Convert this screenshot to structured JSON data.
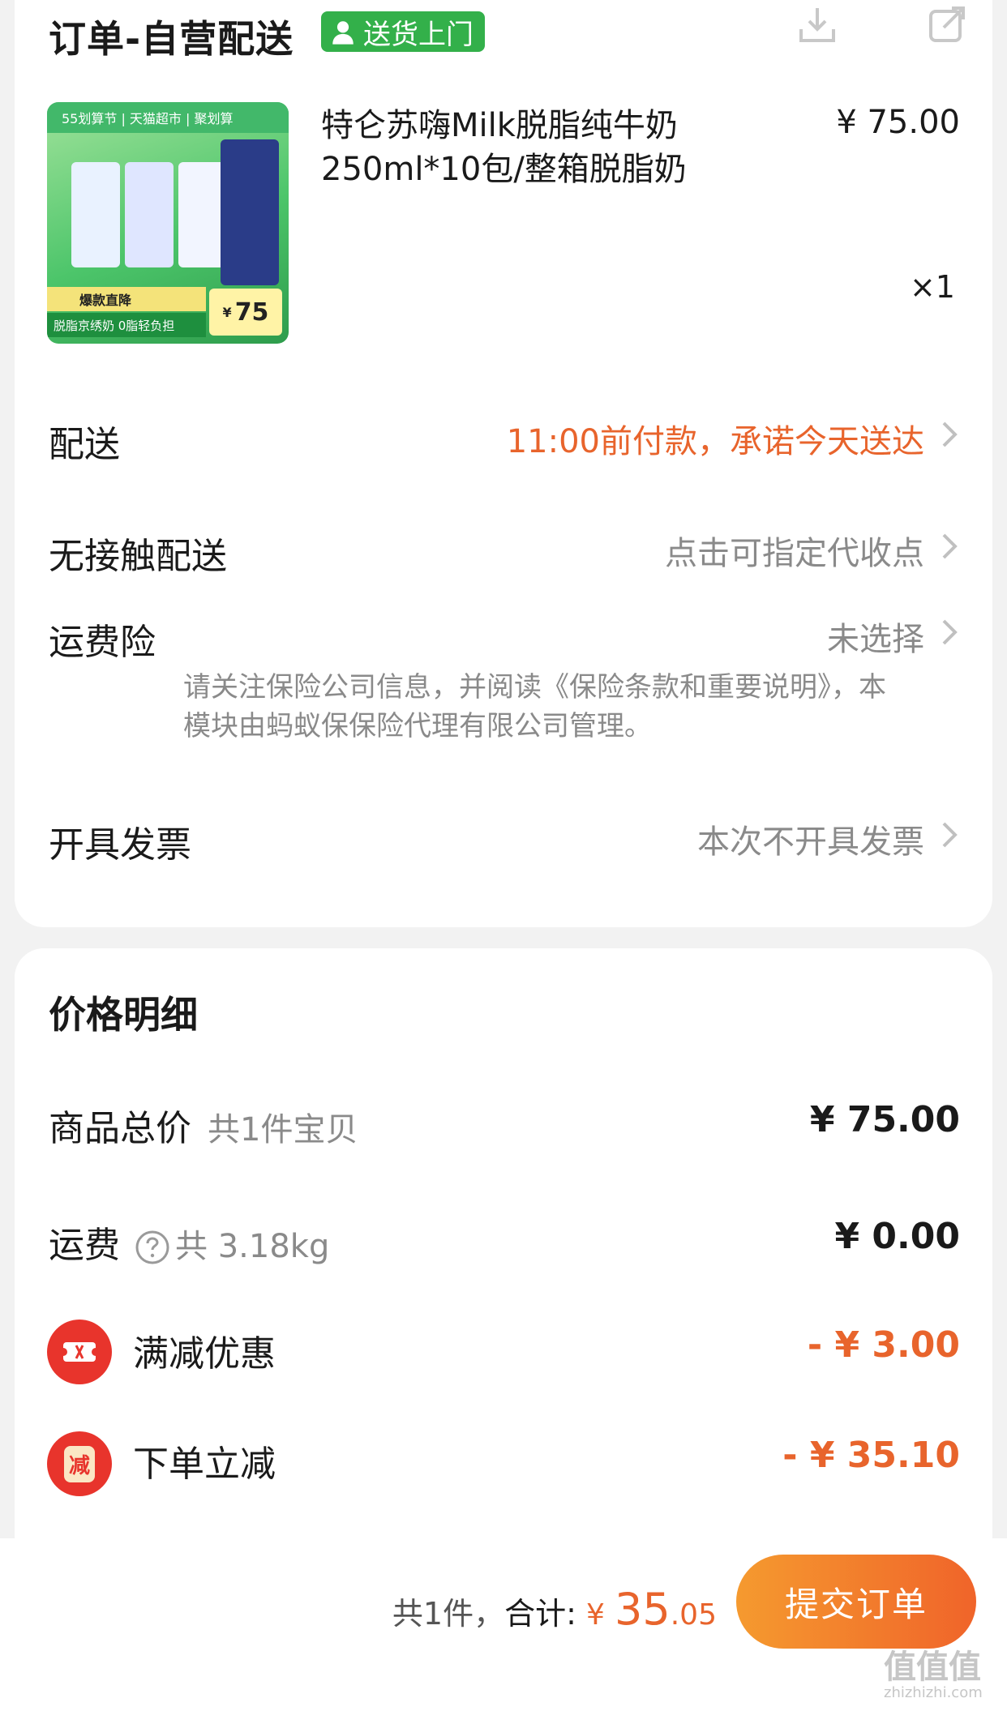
{
  "order": {
    "title": "订单-自营配送",
    "badge": "送货上门",
    "product": {
      "name": "特仑苏嗨Milk脱脂纯牛奶250ml*10包/整箱脱脂奶",
      "price": "¥ 75.00",
      "qty": "×1",
      "image": {
        "banner": "55划算节 | 天猫超市 | 聚划算",
        "promo": "爆款直降",
        "strip": "脱脂京绣奶 0脂轻负担",
        "price_currency": "¥",
        "price": "75"
      }
    },
    "rows": {
      "delivery": {
        "label": "配送",
        "value": "11:00前付款，承诺今天送达"
      },
      "contactless": {
        "label": "无接触配送",
        "value": "点击可指定代收点"
      },
      "insurance": {
        "label": "运费险",
        "value": "未选择",
        "note": "请关注保险公司信息，并阅读《保险条款和重要说明》，本模块由蚂蚁保保险代理有限公司管理。"
      },
      "invoice": {
        "label": "开具发票",
        "value": "本次不开具发票"
      }
    }
  },
  "price": {
    "title": "价格明细",
    "goods_total": {
      "label": "商品总价",
      "sub": "共1件宝贝",
      "value": "¥ 75.00"
    },
    "shipping": {
      "label": "运费",
      "sub": "共 3.18kg",
      "value": "¥ 0.00"
    },
    "full_discount": {
      "label": "满减优惠",
      "value": "- ¥ 3.00"
    },
    "instant_discount": {
      "label": "下单立减",
      "icon_char": "减",
      "value": "- ¥ 35.10"
    }
  },
  "bottom": {
    "count": "共1件，",
    "total_label": "合计:",
    "currency": "¥",
    "total_int": "35",
    "total_dec": ".05",
    "submit": "提交订单"
  },
  "watermark": {
    "logo": "值值值",
    "url": "zhizhizhi.com"
  },
  "colors": {
    "accent": "#e8642c",
    "badge_green": "#33b04a",
    "discount_red": "#e8342c"
  }
}
